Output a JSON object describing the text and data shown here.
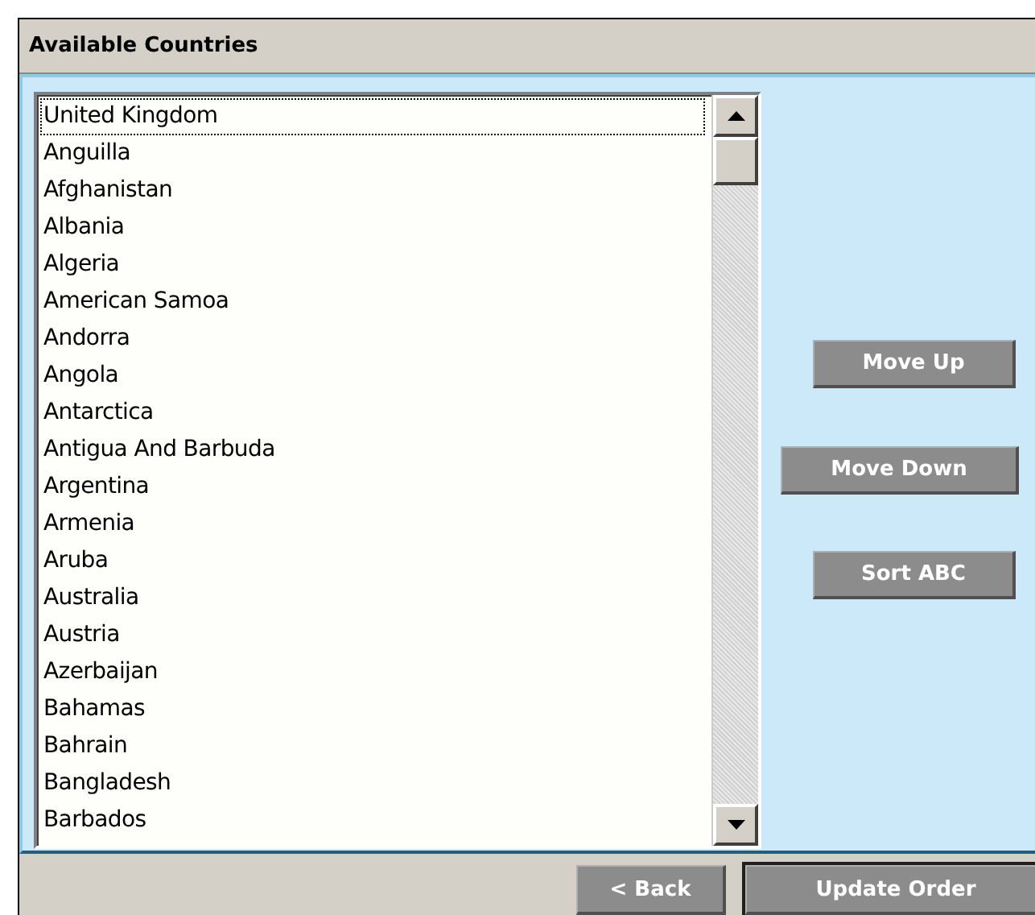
{
  "panel": {
    "title": "Available Countries"
  },
  "list": {
    "items": [
      {
        "label": "United Kingdom",
        "selected": true
      },
      {
        "label": "Anguilla",
        "selected": false
      },
      {
        "label": "Afghanistan",
        "selected": false
      },
      {
        "label": "Albania",
        "selected": false
      },
      {
        "label": "Algeria",
        "selected": false
      },
      {
        "label": "American Samoa",
        "selected": false
      },
      {
        "label": "Andorra",
        "selected": false
      },
      {
        "label": "Angola",
        "selected": false
      },
      {
        "label": "Antarctica",
        "selected": false
      },
      {
        "label": "Antigua And Barbuda",
        "selected": false
      },
      {
        "label": "Argentina",
        "selected": false
      },
      {
        "label": "Armenia",
        "selected": false
      },
      {
        "label": "Aruba",
        "selected": false
      },
      {
        "label": "Australia",
        "selected": false
      },
      {
        "label": "Austria",
        "selected": false
      },
      {
        "label": "Azerbaijan",
        "selected": false
      },
      {
        "label": "Bahamas",
        "selected": false
      },
      {
        "label": "Bahrain",
        "selected": false
      },
      {
        "label": "Bangladesh",
        "selected": false
      },
      {
        "label": "Barbados",
        "selected": false
      }
    ]
  },
  "side_buttons": [
    "Move Up",
    "Move Down",
    "Sort ABC"
  ],
  "footer_buttons": [
    {
      "label": "< Back",
      "kind": "plain"
    },
    {
      "label": "Update Order",
      "kind": "default"
    }
  ]
}
